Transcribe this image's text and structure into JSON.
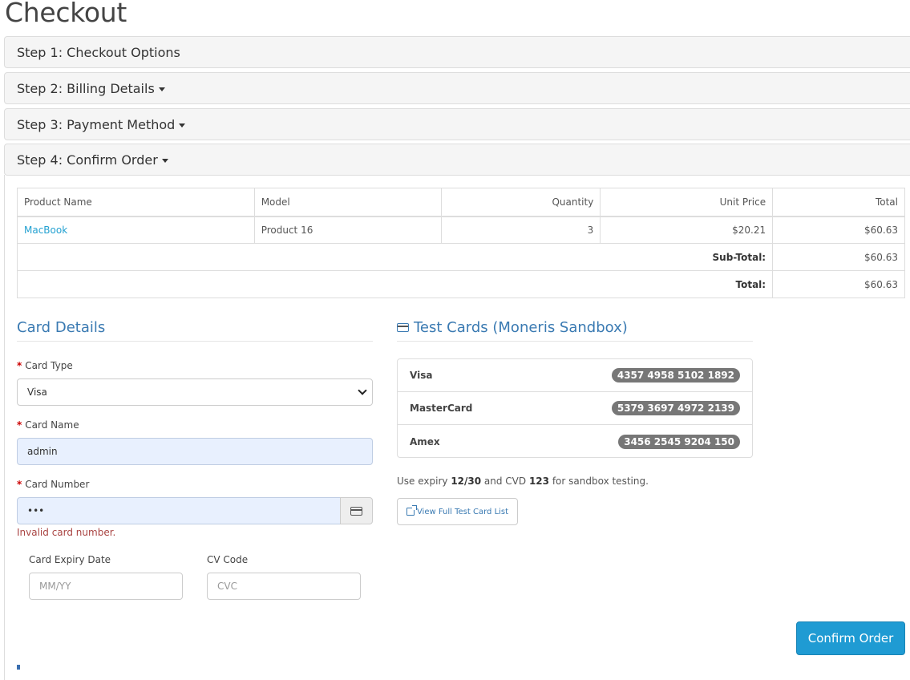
{
  "page": {
    "title": "Checkout"
  },
  "steps": [
    {
      "label": "Step 1: Checkout Options"
    },
    {
      "label": "Step 2: Billing Details"
    },
    {
      "label": "Step 3: Payment Method"
    },
    {
      "label": "Step 4: Confirm Order"
    }
  ],
  "order": {
    "headers": [
      "Product Name",
      "Model",
      "Quantity",
      "Unit Price",
      "Total"
    ],
    "items": [
      {
        "name": "MacBook",
        "model": "Product 16",
        "quantity": "3",
        "unit_price": "$20.21",
        "total": "$60.63"
      }
    ],
    "subtotal_label": "Sub-Total:",
    "subtotal_value": "$60.63",
    "total_label": "Total:",
    "total_value": "$60.63"
  },
  "card_details": {
    "title": "Card Details",
    "card_type_label": "Card Type",
    "card_type_value": "Visa",
    "card_name_label": "Card Name",
    "card_name_value": "admin",
    "card_number_label": "Card Number",
    "card_number_value": "•••",
    "card_number_error": "Invalid card number.",
    "expiry_label": "Card Expiry Date",
    "expiry_placeholder": "MM/YY",
    "cvc_label": "CV Code",
    "cvc_placeholder": "CVC",
    "required_mark": "*"
  },
  "test_cards": {
    "title": "Test Cards (Moneris Sandbox)",
    "cards": [
      {
        "brand": "Visa",
        "number": "4357 4958 5102 1892"
      },
      {
        "brand": "MasterCard",
        "number": "5379 3697 4972 2139"
      },
      {
        "brand": "Amex",
        "number": "3456 2545 9204 150"
      }
    ],
    "hint_prefix": "Use expiry ",
    "hint_expiry": "12/30",
    "hint_middle": " and CVD ",
    "hint_cvd": "123",
    "hint_suffix": " for sandbox testing.",
    "view_list_label": "View Full Test Card List"
  },
  "actions": {
    "confirm_label": "Confirm Order"
  },
  "icons": {
    "caret": "caret-down-icon",
    "card": "credit-card-icon",
    "external": "external-link-icon"
  },
  "colors": {
    "accent": "#1f9bd3",
    "heading": "#3a7ab2",
    "error": "#a94442",
    "link": "#23a1d1"
  }
}
